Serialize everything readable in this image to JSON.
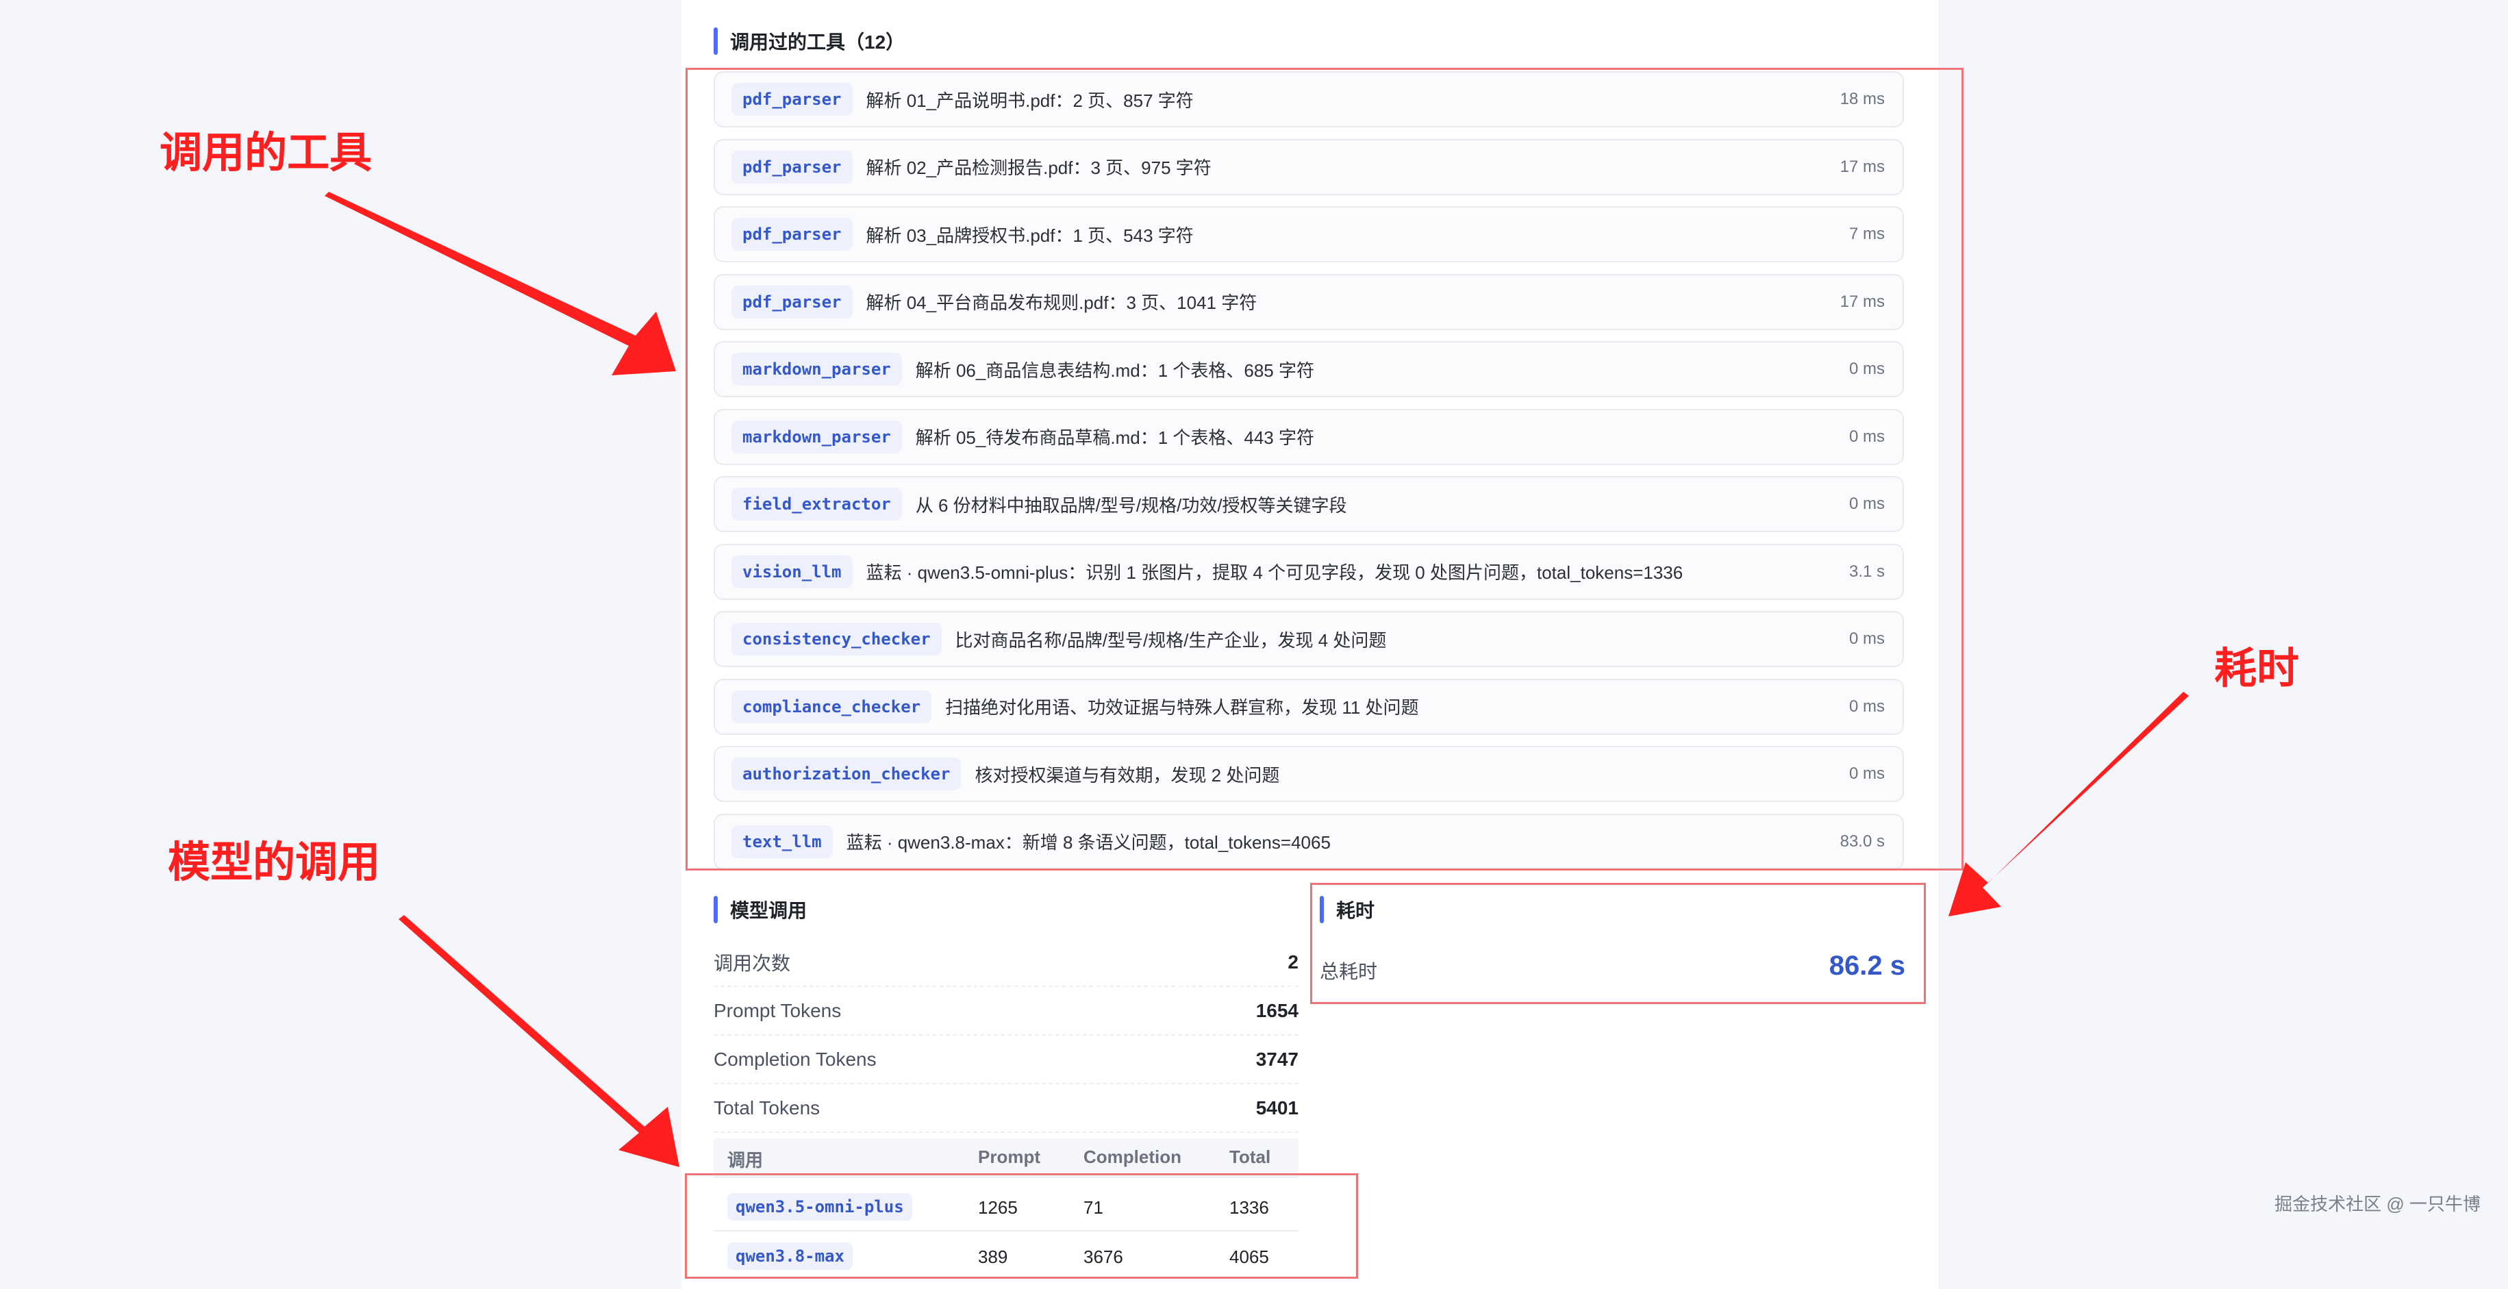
{
  "tools_section": {
    "title": "调用过的工具（12）",
    "items": [
      {
        "tool": "pdf_parser",
        "desc": "解析 01_产品说明书.pdf：2 页、857 字符",
        "time": "18 ms"
      },
      {
        "tool": "pdf_parser",
        "desc": "解析 02_产品检测报告.pdf：3 页、975 字符",
        "time": "17 ms"
      },
      {
        "tool": "pdf_parser",
        "desc": "解析 03_品牌授权书.pdf：1 页、543 字符",
        "time": "7 ms"
      },
      {
        "tool": "pdf_parser",
        "desc": "解析 04_平台商品发布规则.pdf：3 页、1041 字符",
        "time": "17 ms"
      },
      {
        "tool": "markdown_parser",
        "desc": "解析 06_商品信息表结构.md：1 个表格、685 字符",
        "time": "0 ms"
      },
      {
        "tool": "markdown_parser",
        "desc": "解析 05_待发布商品草稿.md：1 个表格、443 字符",
        "time": "0 ms"
      },
      {
        "tool": "field_extractor",
        "desc": "从 6 份材料中抽取品牌/型号/规格/功效/授权等关键字段",
        "time": "0 ms"
      },
      {
        "tool": "vision_llm",
        "desc": "蓝耘 · qwen3.5-omni-plus：识别 1 张图片，提取 4 个可见字段，发现 0 处图片问题，total_tokens=1336",
        "time": "3.1 s"
      },
      {
        "tool": "consistency_checker",
        "desc": "比对商品名称/品牌/型号/规格/生产企业，发现 4 处问题",
        "time": "0 ms"
      },
      {
        "tool": "compliance_checker",
        "desc": "扫描绝对化用语、功效证据与特殊人群宣称，发现 11 处问题",
        "time": "0 ms"
      },
      {
        "tool": "authorization_checker",
        "desc": "核对授权渠道与有效期，发现 2 处问题",
        "time": "0 ms"
      },
      {
        "tool": "text_llm",
        "desc": "蓝耘 · qwen3.8-max：新增 8 条语义问题，total_tokens=4065",
        "time": "83.0 s"
      }
    ]
  },
  "model_section": {
    "title": "模型调用",
    "stats": [
      {
        "label": "调用次数",
        "value": "2"
      },
      {
        "label": "Prompt Tokens",
        "value": "1654"
      },
      {
        "label": "Completion Tokens",
        "value": "3747"
      },
      {
        "label": "Total Tokens",
        "value": "5401"
      }
    ],
    "table": {
      "headers": [
        "调用",
        "Prompt",
        "Completion",
        "Total"
      ],
      "rows": [
        {
          "model": "qwen3.5-omni-plus",
          "prompt": "1265",
          "completion": "71",
          "total": "1336"
        },
        {
          "model": "qwen3.8-max",
          "prompt": "389",
          "completion": "3676",
          "total": "4065"
        }
      ]
    }
  },
  "time_section": {
    "title": "耗时",
    "label": "总耗时",
    "value": "86.2 s"
  },
  "annotations": {
    "tools": "调用的工具",
    "models": "模型的调用",
    "time": "耗时"
  },
  "watermark": "掘金技术社区 @ 一只牛博",
  "colors": {
    "accent": "#4a6cf7",
    "highlight_box": "#ef7478",
    "annotation": "#ff1f1f",
    "time_value": "#3558c9"
  }
}
